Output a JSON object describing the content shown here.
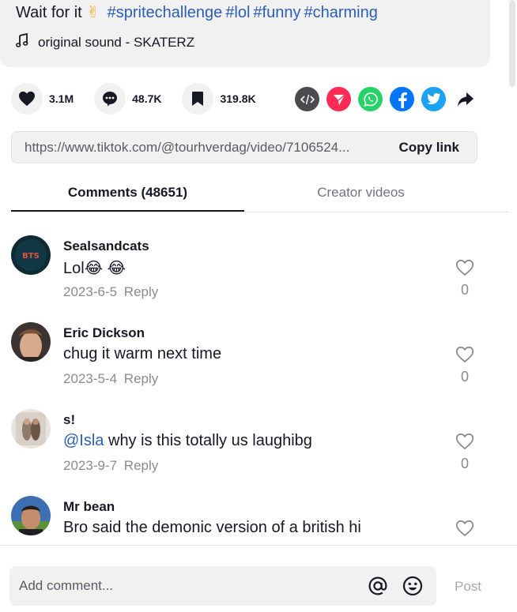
{
  "description": {
    "caption_text": "Wait for it",
    "caption_emoji": "✌",
    "hashtags": [
      "#spritechallenge",
      "#lol",
      "#funny",
      "#charming"
    ],
    "sound": "original sound - SKATERZ"
  },
  "actions": {
    "likes": "3.1M",
    "comments": "48.7K",
    "saves": "319.8K"
  },
  "share_icons": [
    "embed-icon",
    "send-icon",
    "whatsapp-icon",
    "facebook-icon",
    "twitter-icon",
    "share-arrow-icon"
  ],
  "link": {
    "url": "https://www.tiktok.com/@tourhverdag/video/7106524...",
    "copy_label": "Copy link"
  },
  "tabs": [
    {
      "label": "Comments (48651)",
      "active": true
    },
    {
      "label": "Creator videos",
      "active": false
    }
  ],
  "comments": [
    {
      "user": "Sealsandcats",
      "mention": "",
      "text": "Lol😂 😂",
      "date": "2023-6-5",
      "reply": "Reply",
      "likes": "0"
    },
    {
      "user": "Eric Dickson",
      "mention": "",
      "text": "chug it warm next time",
      "date": "2023-5-4",
      "reply": "Reply",
      "likes": "0"
    },
    {
      "user": "s!",
      "mention": "@Isla",
      "text": " why is this totally us laughibg",
      "date": "2023-9-7",
      "reply": "Reply",
      "likes": "0"
    },
    {
      "user": "Mr bean",
      "mention": "",
      "text": "Bro said the demonic version of a british hi",
      "date": "",
      "reply": "",
      "likes": ""
    }
  ],
  "composer": {
    "placeholder": "Add comment...",
    "post_label": "Post"
  },
  "colors": {
    "hashtag": "#2b5db9",
    "embed": "#4a4a4f",
    "send": "#fe2c55",
    "whatsapp": "#25d366",
    "facebook": "#0075fa",
    "twitter": "#1da1f2"
  }
}
